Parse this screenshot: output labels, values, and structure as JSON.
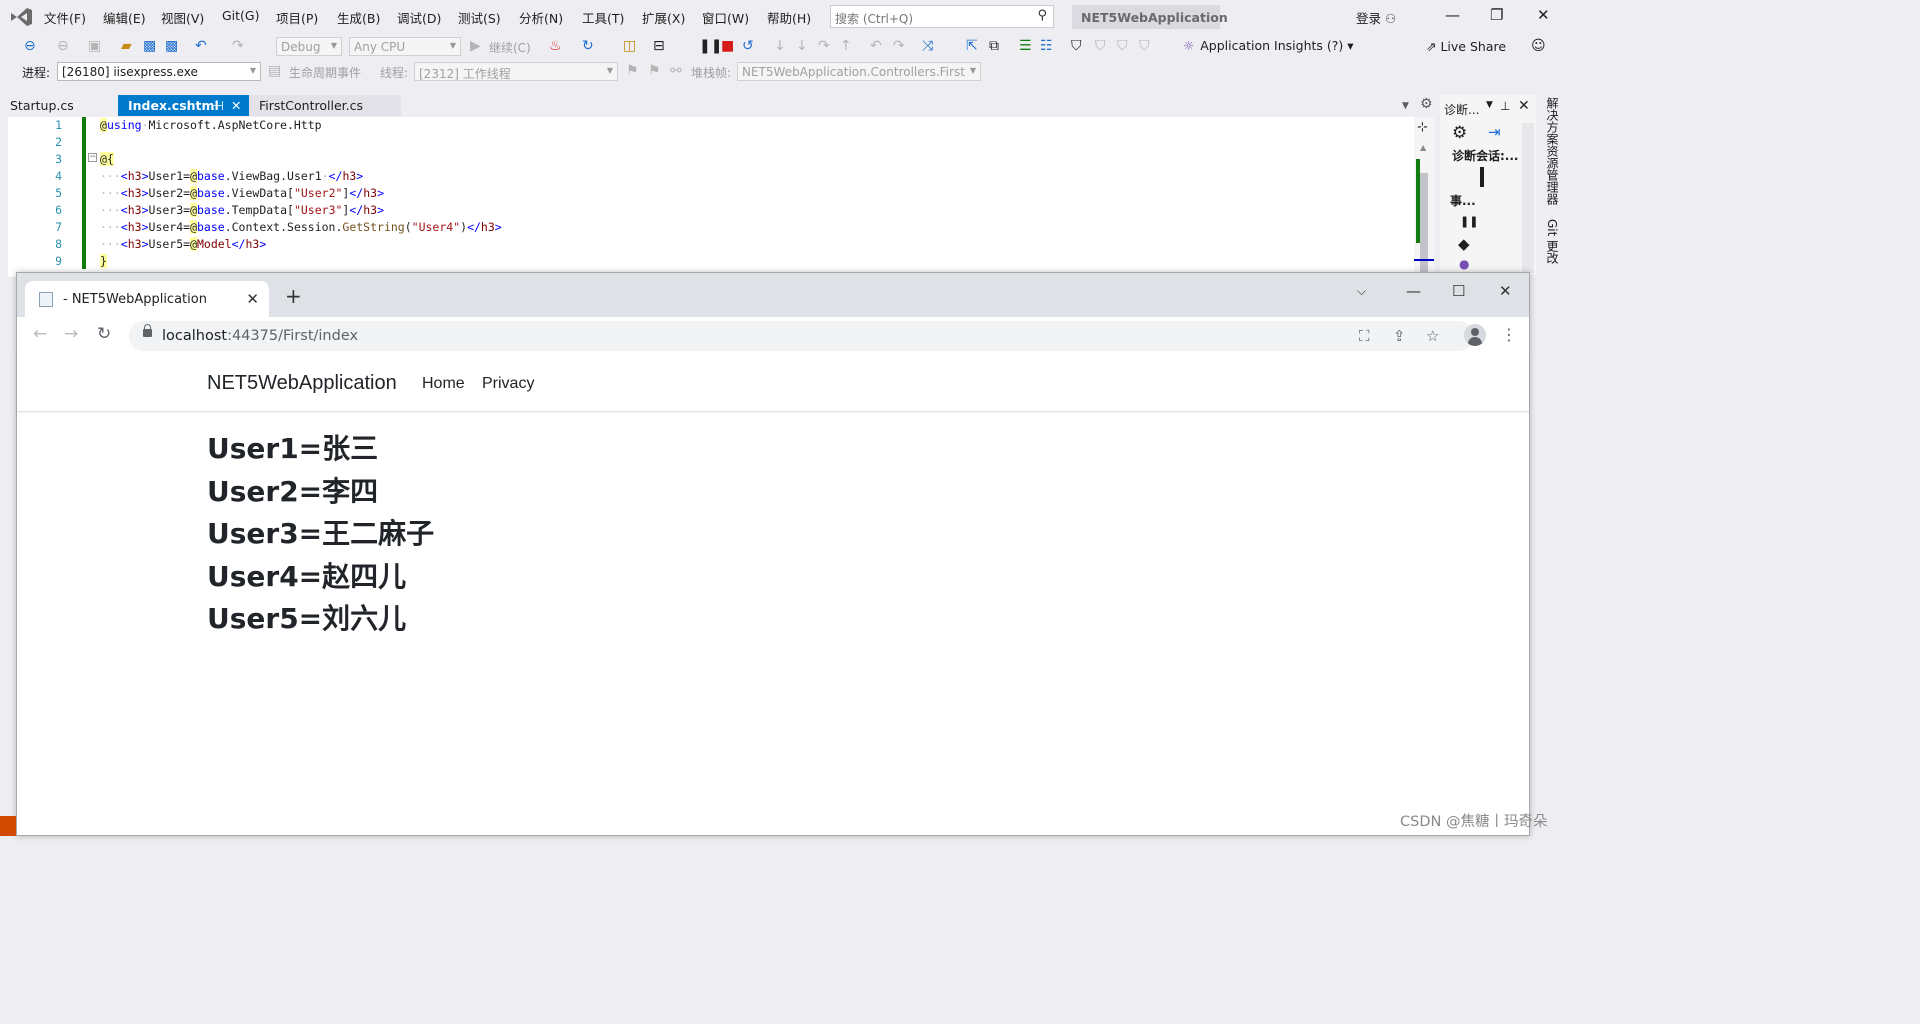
{
  "vs": {
    "menu": [
      "文件(F)",
      "编辑(E)",
      "视图(V)",
      "Git(G)",
      "项目(P)",
      "生成(B)",
      "调试(D)",
      "测试(S)",
      "分析(N)",
      "工具(T)",
      "扩展(X)",
      "窗口(W)",
      "帮助(H)"
    ],
    "search_placeholder": "搜索 (Ctrl+Q)",
    "solution_name": "NET5WebApplication",
    "login_label": "登录",
    "toolbar": {
      "config": "Debug",
      "platform": "Any CPU",
      "continue_label": "继续(C)",
      "insights_label": "Application Insights (?)",
      "liveshare_label": "Live Share",
      "process_label": "进程:",
      "process_value": "[26180] iisexpress.exe",
      "lifecycle_label": "生命周期事件",
      "thread_label": "线程:",
      "thread_value": "[2312] 工作线程",
      "stackframe_label": "堆栈帧:",
      "stackframe_value": "NET5WebApplication.Controllers.First"
    },
    "tabs": [
      {
        "label": "Startup.cs"
      },
      {
        "label": "Index.cshtml"
      },
      {
        "label": "FirstController.cs"
      }
    ],
    "code_lines": [
      {
        "num": "1",
        "tokens": [
          [
            "tok-razor",
            "@"
          ],
          [
            "tok-kw",
            "using"
          ],
          [
            "tok-dot",
            "·"
          ],
          [
            "tok-plain",
            "Microsoft.AspNetCore.Http"
          ]
        ]
      },
      {
        "num": "2",
        "tokens": []
      },
      {
        "num": "3",
        "tokens": [
          [
            "tok-razor",
            "@{"
          ]
        ]
      },
      {
        "num": "4",
        "tokens": [
          [
            "tok-dot",
            "···"
          ],
          [
            "tok-kw",
            "<"
          ],
          [
            "tok-tag",
            "h3"
          ],
          [
            "tok-kw",
            ">"
          ],
          [
            "tok-plain",
            "User1="
          ],
          [
            "tok-razor",
            "@"
          ],
          [
            "tok-kw",
            "base"
          ],
          [
            "tok-plain",
            ".ViewBag.User1"
          ],
          [
            "tok-dot",
            "·"
          ],
          [
            "tok-kw",
            "</"
          ],
          [
            "tok-tag",
            "h3"
          ],
          [
            "tok-kw",
            ">"
          ]
        ]
      },
      {
        "num": "5",
        "tokens": [
          [
            "tok-dot",
            "···"
          ],
          [
            "tok-kw",
            "<"
          ],
          [
            "tok-tag",
            "h3"
          ],
          [
            "tok-kw",
            ">"
          ],
          [
            "tok-plain",
            "User2="
          ],
          [
            "tok-razor",
            "@"
          ],
          [
            "tok-kw",
            "base"
          ],
          [
            "tok-plain",
            ".ViewData["
          ],
          [
            "tok-str",
            "\"User2\""
          ],
          [
            "tok-plain",
            "]"
          ],
          [
            "tok-kw",
            "</"
          ],
          [
            "tok-tag",
            "h3"
          ],
          [
            "tok-kw",
            ">"
          ]
        ]
      },
      {
        "num": "6",
        "tokens": [
          [
            "tok-dot",
            "···"
          ],
          [
            "tok-kw",
            "<"
          ],
          [
            "tok-tag",
            "h3"
          ],
          [
            "tok-kw",
            ">"
          ],
          [
            "tok-plain",
            "User3="
          ],
          [
            "tok-razor",
            "@"
          ],
          [
            "tok-kw",
            "base"
          ],
          [
            "tok-plain",
            ".TempData["
          ],
          [
            "tok-str",
            "\"User3\""
          ],
          [
            "tok-plain",
            "]"
          ],
          [
            "tok-kw",
            "</"
          ],
          [
            "tok-tag",
            "h3"
          ],
          [
            "tok-kw",
            ">"
          ]
        ]
      },
      {
        "num": "7",
        "tokens": [
          [
            "tok-dot",
            "···"
          ],
          [
            "tok-kw",
            "<"
          ],
          [
            "tok-tag",
            "h3"
          ],
          [
            "tok-kw",
            ">"
          ],
          [
            "tok-plain",
            "User4="
          ],
          [
            "tok-razor",
            "@"
          ],
          [
            "tok-kw",
            "base"
          ],
          [
            "tok-plain",
            ".Context.Session."
          ],
          [
            "tok-method",
            "GetString"
          ],
          [
            "tok-plain",
            "("
          ],
          [
            "tok-str",
            "\"User4\""
          ],
          [
            "tok-plain",
            ")"
          ],
          [
            "tok-kw",
            "</"
          ],
          [
            "tok-tag",
            "h3"
          ],
          [
            "tok-kw",
            ">"
          ]
        ]
      },
      {
        "num": "8",
        "tokens": [
          [
            "tok-dot",
            "···"
          ],
          [
            "tok-kw",
            "<"
          ],
          [
            "tok-tag",
            "h3"
          ],
          [
            "tok-kw",
            ">"
          ],
          [
            "tok-plain",
            "User5="
          ],
          [
            "tok-razor",
            "@"
          ],
          [
            "tok-tag",
            "Model"
          ],
          [
            "tok-kw",
            "</"
          ],
          [
            "tok-tag",
            "h3"
          ],
          [
            "tok-kw",
            ">"
          ]
        ]
      },
      {
        "num": "9",
        "tokens": [
          [
            "tok-razor",
            "}"
          ]
        ]
      }
    ],
    "diag_panel": {
      "title": "诊断...",
      "session": "诊断会话:...",
      "events": "事..."
    },
    "side_tabs": [
      "解决方案资源管理器",
      "Git 更改"
    ]
  },
  "browser": {
    "tab_title": "- NET5WebApplication",
    "url_host": "localhost",
    "url_rest": ":44375/First/index"
  },
  "site": {
    "brand": "NET5WebApplication",
    "nav": [
      "Home",
      "Privacy"
    ],
    "users": [
      {
        "label": "User1=",
        "value": "张三"
      },
      {
        "label": "User2=",
        "value": "李四"
      },
      {
        "label": "User3=",
        "value": "王二麻子"
      },
      {
        "label": "User4=",
        "value": "赵四儿"
      },
      {
        "label": "User5=",
        "value": "刘六儿"
      }
    ]
  },
  "watermark": "CSDN @焦糖丨玛奇朵",
  "colors": {
    "accent": "#007acc",
    "change_bar": "#107c10"
  }
}
